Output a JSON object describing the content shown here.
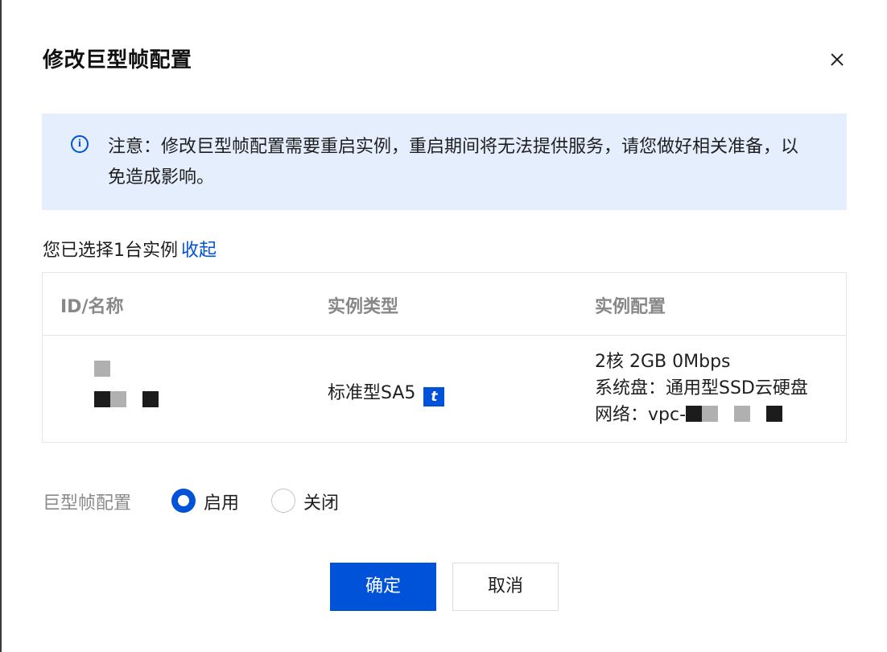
{
  "dialog": {
    "title": "修改巨型帧配置",
    "close_icon": "close-icon"
  },
  "notice": {
    "icon": "info-icon",
    "icon_glyph": "i",
    "text": "注意：修改巨型帧配置需要重启实例，重启期间将无法提供服务，请您做好相关准备，以免造成影响。"
  },
  "selection": {
    "text": "您已选择1台实例",
    "toggle_label": "收起"
  },
  "table": {
    "headers": [
      "ID/名称",
      "实例类型",
      "实例配置"
    ],
    "rows": [
      {
        "id_masked": true,
        "type": "标准型SA5",
        "type_badge": "t",
        "config": {
          "spec": "2核 2GB 0Mbps",
          "disk": "系统盘：通用型SSD云硬盘",
          "network_prefix": "网络：vpc-"
        }
      }
    ]
  },
  "jumbo_frame": {
    "label": "巨型帧配置",
    "options": [
      {
        "label": "启用",
        "selected": true
      },
      {
        "label": "关闭",
        "selected": false
      }
    ]
  },
  "actions": {
    "confirm_label": "确定",
    "cancel_label": "取消"
  },
  "colors": {
    "primary": "#0052d9",
    "notice_bg": "#e5eefd",
    "border": "#e3e5e8"
  }
}
